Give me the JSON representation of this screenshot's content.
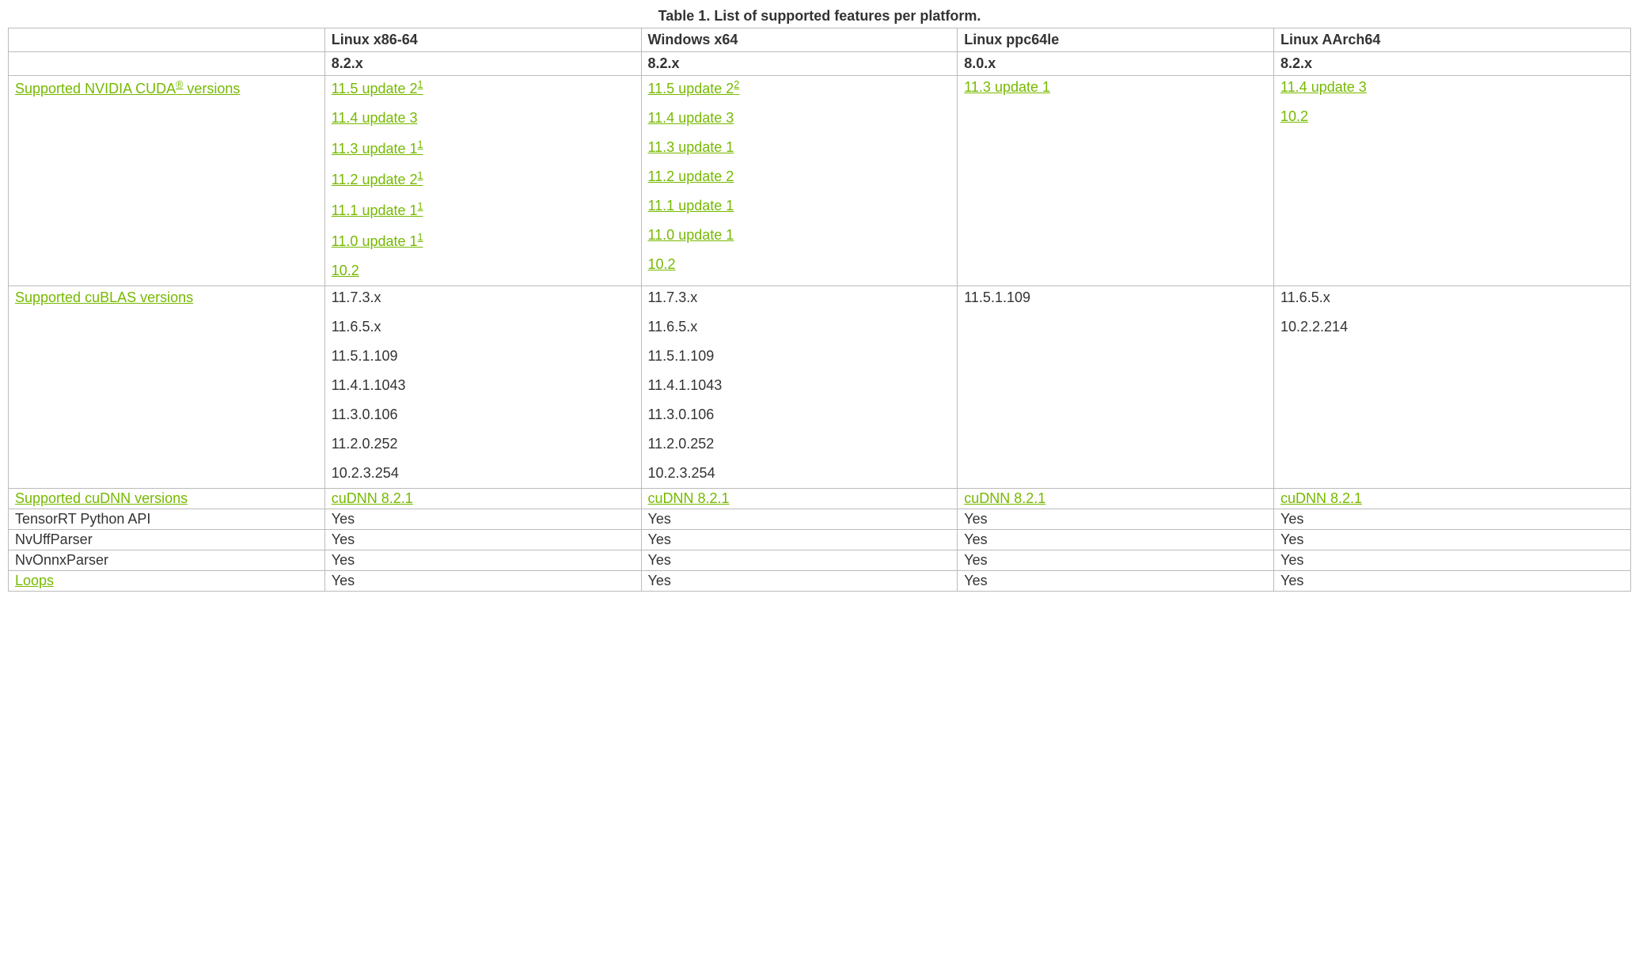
{
  "caption": "Table 1. List of supported features per platform.",
  "columns": [
    "Linux x86-64",
    "Windows x64",
    "Linux ppc64le",
    "Linux AArch64"
  ],
  "versions_row": [
    "8.2.x",
    "8.2.x",
    "8.0.x",
    "8.2.x"
  ],
  "cuda": {
    "label_prefix": "Supported NVIDIA CUDA",
    "label_suffix": " versions",
    "registered": "®",
    "linux_x86": [
      {
        "text": "11.5 update 2",
        "note": "1"
      },
      {
        "text": "11.4 update 3"
      },
      {
        "text": "11.3 update 1",
        "note": "1"
      },
      {
        "text": "11.2 update 2",
        "note": "1"
      },
      {
        "text": "11.1 update 1",
        "note": "1"
      },
      {
        "text": "11.0 update 1",
        "note": "1"
      },
      {
        "text": "10.2"
      }
    ],
    "windows": [
      {
        "text": "11.5 update 2",
        "note": "2"
      },
      {
        "text": "11.4 update 3"
      },
      {
        "text": "11.3 update 1"
      },
      {
        "text": "11.2 update 2"
      },
      {
        "text": "11.1 update 1"
      },
      {
        "text": "11.0 update 1"
      },
      {
        "text": "10.2"
      }
    ],
    "ppc64le": [
      {
        "text": "11.3 update 1"
      }
    ],
    "aarch64": [
      {
        "text": "11.4 update 3"
      },
      {
        "text": "10.2"
      }
    ]
  },
  "cublas": {
    "label": "Supported cuBLAS versions",
    "linux_x86": [
      "11.7.3.x",
      "11.6.5.x",
      "11.5.1.109",
      "11.4.1.1043",
      "11.3.0.106",
      "11.2.0.252",
      "10.2.3.254"
    ],
    "windows": [
      "11.7.3.x",
      "11.6.5.x",
      "11.5.1.109",
      "11.4.1.1043",
      "11.3.0.106",
      "11.2.0.252",
      "10.2.3.254"
    ],
    "ppc64le": [
      "11.5.1.109"
    ],
    "aarch64": [
      "11.6.5.x",
      "10.2.2.214"
    ]
  },
  "cudnn": {
    "label": "Supported cuDNN versions",
    "value": "cuDNN 8.2.1"
  },
  "simple_rows": [
    {
      "label": "TensorRT Python API",
      "link": false,
      "values": [
        "Yes",
        "Yes",
        "Yes",
        "Yes"
      ]
    },
    {
      "label": "NvUffParser",
      "link": false,
      "values": [
        "Yes",
        "Yes",
        "Yes",
        "Yes"
      ]
    },
    {
      "label": "NvOnnxParser",
      "link": false,
      "values": [
        "Yes",
        "Yes",
        "Yes",
        "Yes"
      ]
    },
    {
      "label": "Loops",
      "link": true,
      "values": [
        "Yes",
        "Yes",
        "Yes",
        "Yes"
      ]
    }
  ]
}
